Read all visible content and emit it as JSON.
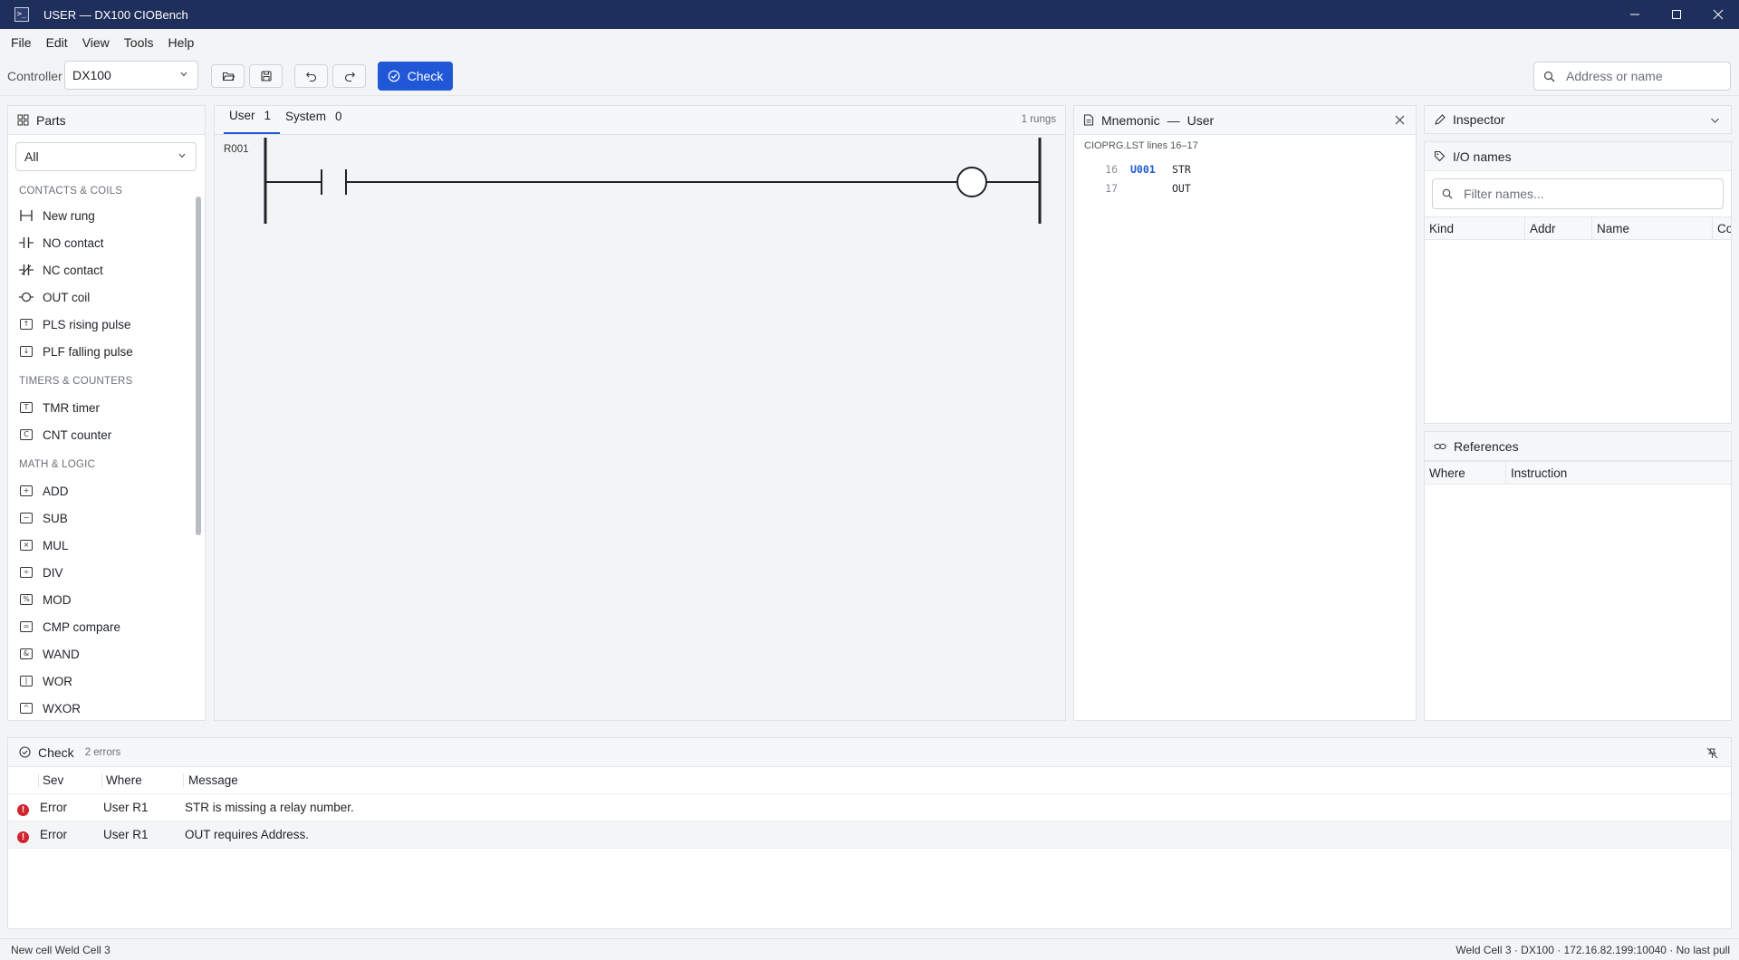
{
  "window": {
    "title": "USER — DX100 CIOBench",
    "app_icon_glyph": ">_",
    "colors": {
      "titlebar": "#1f2f5c",
      "accent": "#1f57d6",
      "error": "#d1242f"
    }
  },
  "menu": [
    "File",
    "Edit",
    "View",
    "Tools",
    "Help"
  ],
  "toolbar": {
    "controller_label": "Controller",
    "controller_value": "DX100",
    "check_label": "Check",
    "search_placeholder": "Address or name"
  },
  "parts": {
    "title": "Parts",
    "filter_value": "All",
    "categories": [
      {
        "name": "CONTACTS & COILS",
        "items": [
          {
            "label": "New rung",
            "icon": "new-rung-icon"
          },
          {
            "label": "NO contact",
            "icon": "no-contact-icon"
          },
          {
            "label": "NC contact",
            "icon": "nc-contact-icon"
          },
          {
            "label": "OUT coil",
            "icon": "coil-icon"
          },
          {
            "label": "PLS rising pulse",
            "icon": "pulse-up-icon",
            "glyph": "↑"
          },
          {
            "label": "PLF falling pulse",
            "icon": "pulse-down-icon",
            "glyph": "↓"
          }
        ]
      },
      {
        "name": "TIMERS & COUNTERS",
        "items": [
          {
            "label": "TMR timer",
            "icon": "timer-icon",
            "glyph": "T"
          },
          {
            "label": "CNT counter",
            "icon": "counter-icon",
            "glyph": "C"
          }
        ]
      },
      {
        "name": "MATH & LOGIC",
        "items": [
          {
            "label": "ADD",
            "icon": "add-icon",
            "glyph": "+"
          },
          {
            "label": "SUB",
            "icon": "sub-icon",
            "glyph": "−"
          },
          {
            "label": "MUL",
            "icon": "mul-icon",
            "glyph": "×"
          },
          {
            "label": "DIV",
            "icon": "div-icon",
            "glyph": "÷"
          },
          {
            "label": "MOD",
            "icon": "mod-icon",
            "glyph": "%"
          },
          {
            "label": "CMP compare",
            "icon": "compare-icon",
            "glyph": "="
          },
          {
            "label": "WAND",
            "icon": "wand-icon",
            "glyph": "&"
          },
          {
            "label": "WOR",
            "icon": "wor-icon",
            "glyph": "|"
          },
          {
            "label": "WXOR",
            "icon": "wxor-icon",
            "glyph": "^"
          }
        ]
      }
    ]
  },
  "ladder": {
    "tabs": [
      {
        "label": "User",
        "count": "1",
        "active": true
      },
      {
        "label": "System",
        "count": "0",
        "active": false
      }
    ],
    "rungs_count": "1 rungs",
    "rung_label": "R001"
  },
  "mnemonic": {
    "title": "Mnemonic",
    "separator": "—",
    "context": "User",
    "source": "CIOPRG.LST lines 16–17",
    "lines": [
      {
        "num": "16",
        "addr": "U001",
        "op": "STR"
      },
      {
        "num": "17",
        "addr": "",
        "op": "OUT"
      }
    ]
  },
  "inspector": {
    "title": "Inspector",
    "io_names": {
      "title": "I/O names",
      "filter_placeholder": "Filter names...",
      "columns": [
        "Kind",
        "Addr",
        "Name",
        "Co"
      ]
    },
    "references": {
      "title": "References",
      "columns": [
        "Where",
        "Instruction"
      ]
    }
  },
  "check_panel": {
    "title": "Check",
    "count": "2 errors",
    "columns": [
      "Sev",
      "Where",
      "Message"
    ],
    "rows": [
      {
        "sev": "Error",
        "where": "User R1",
        "message": "STR is missing a relay number."
      },
      {
        "sev": "Error",
        "where": "User R1",
        "message": "OUT requires Address."
      }
    ]
  },
  "status": {
    "left": "New cell Weld Cell 3",
    "right": "Weld Cell 3 · DX100 · 172.16.82.199:10040 · No last pull"
  }
}
